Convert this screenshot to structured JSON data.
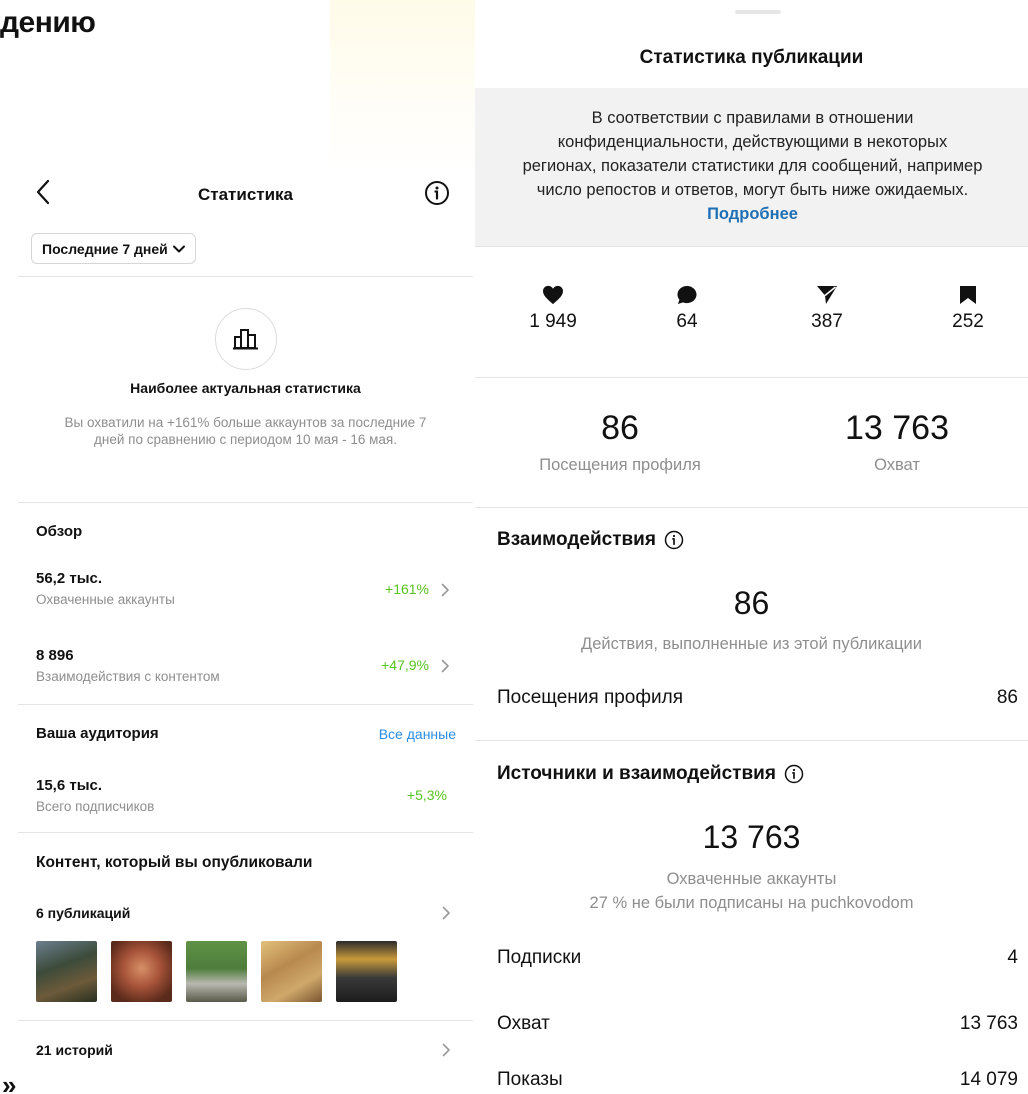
{
  "page": {
    "title": "дению",
    "bottom_fragment": "»"
  },
  "left": {
    "header": {
      "title": "Статистика"
    },
    "period": {
      "label": "Последние 7 дней"
    },
    "insight": {
      "title": "Наиболее актуальная статистика",
      "description": "Вы охватили на +161% больше аккаунтов за последние 7 дней по сравнению с периодом 10 мая - 16 мая."
    },
    "overview": {
      "title": "Обзор",
      "items": [
        {
          "value": "56,2 тыс.",
          "label": "Охваченные аккаунты",
          "change": "+161%"
        },
        {
          "value": "8 896",
          "label": "Взаимодействия с контентом",
          "change": "+47,9%"
        }
      ]
    },
    "audience": {
      "title": "Ваша аудитория",
      "all_data": "Все данные",
      "value": "15,6 тыс.",
      "label": "Всего подписчиков",
      "change": "+5,3%"
    },
    "content": {
      "title": "Контент, который вы опубликовали",
      "posts_label": "6 публикаций",
      "stories_label": "21 историй"
    }
  },
  "right": {
    "title": "Статистика публикации",
    "notice": {
      "text": "В соответствии с правилами в отношении конфиденциальности, действующими в некоторых регионах, показатели статистики для сообщений, например число репостов и ответов, могут быть ниже ожидаемых.",
      "link": "Подробнее"
    },
    "counts": [
      {
        "icon": "heart-icon",
        "value": "1 949"
      },
      {
        "icon": "comment-icon",
        "value": "64"
      },
      {
        "icon": "share-icon",
        "value": "387"
      },
      {
        "icon": "bookmark-icon",
        "value": "252"
      }
    ],
    "summary": [
      {
        "value": "86",
        "label": "Посещения профиля"
      },
      {
        "value": "13 763",
        "label": "Охват"
      }
    ],
    "interactions": {
      "title": "Взаимодействия",
      "value": "86",
      "subtitle": "Действия, выполненные из этой публикации",
      "rows": [
        {
          "label": "Посещения профиля",
          "value": "86"
        }
      ]
    },
    "sources": {
      "title": "Источники и взаимодействия",
      "value": "13 763",
      "subtitle": "Охваченные аккаунты",
      "subtitle2": "27 % не были подписаны на puchkovodom",
      "rows": [
        {
          "label": "Подписки",
          "value": "4"
        },
        {
          "label": "Охват",
          "value": "13 763"
        },
        {
          "label": "Показы",
          "value": "14 079"
        }
      ]
    }
  }
}
